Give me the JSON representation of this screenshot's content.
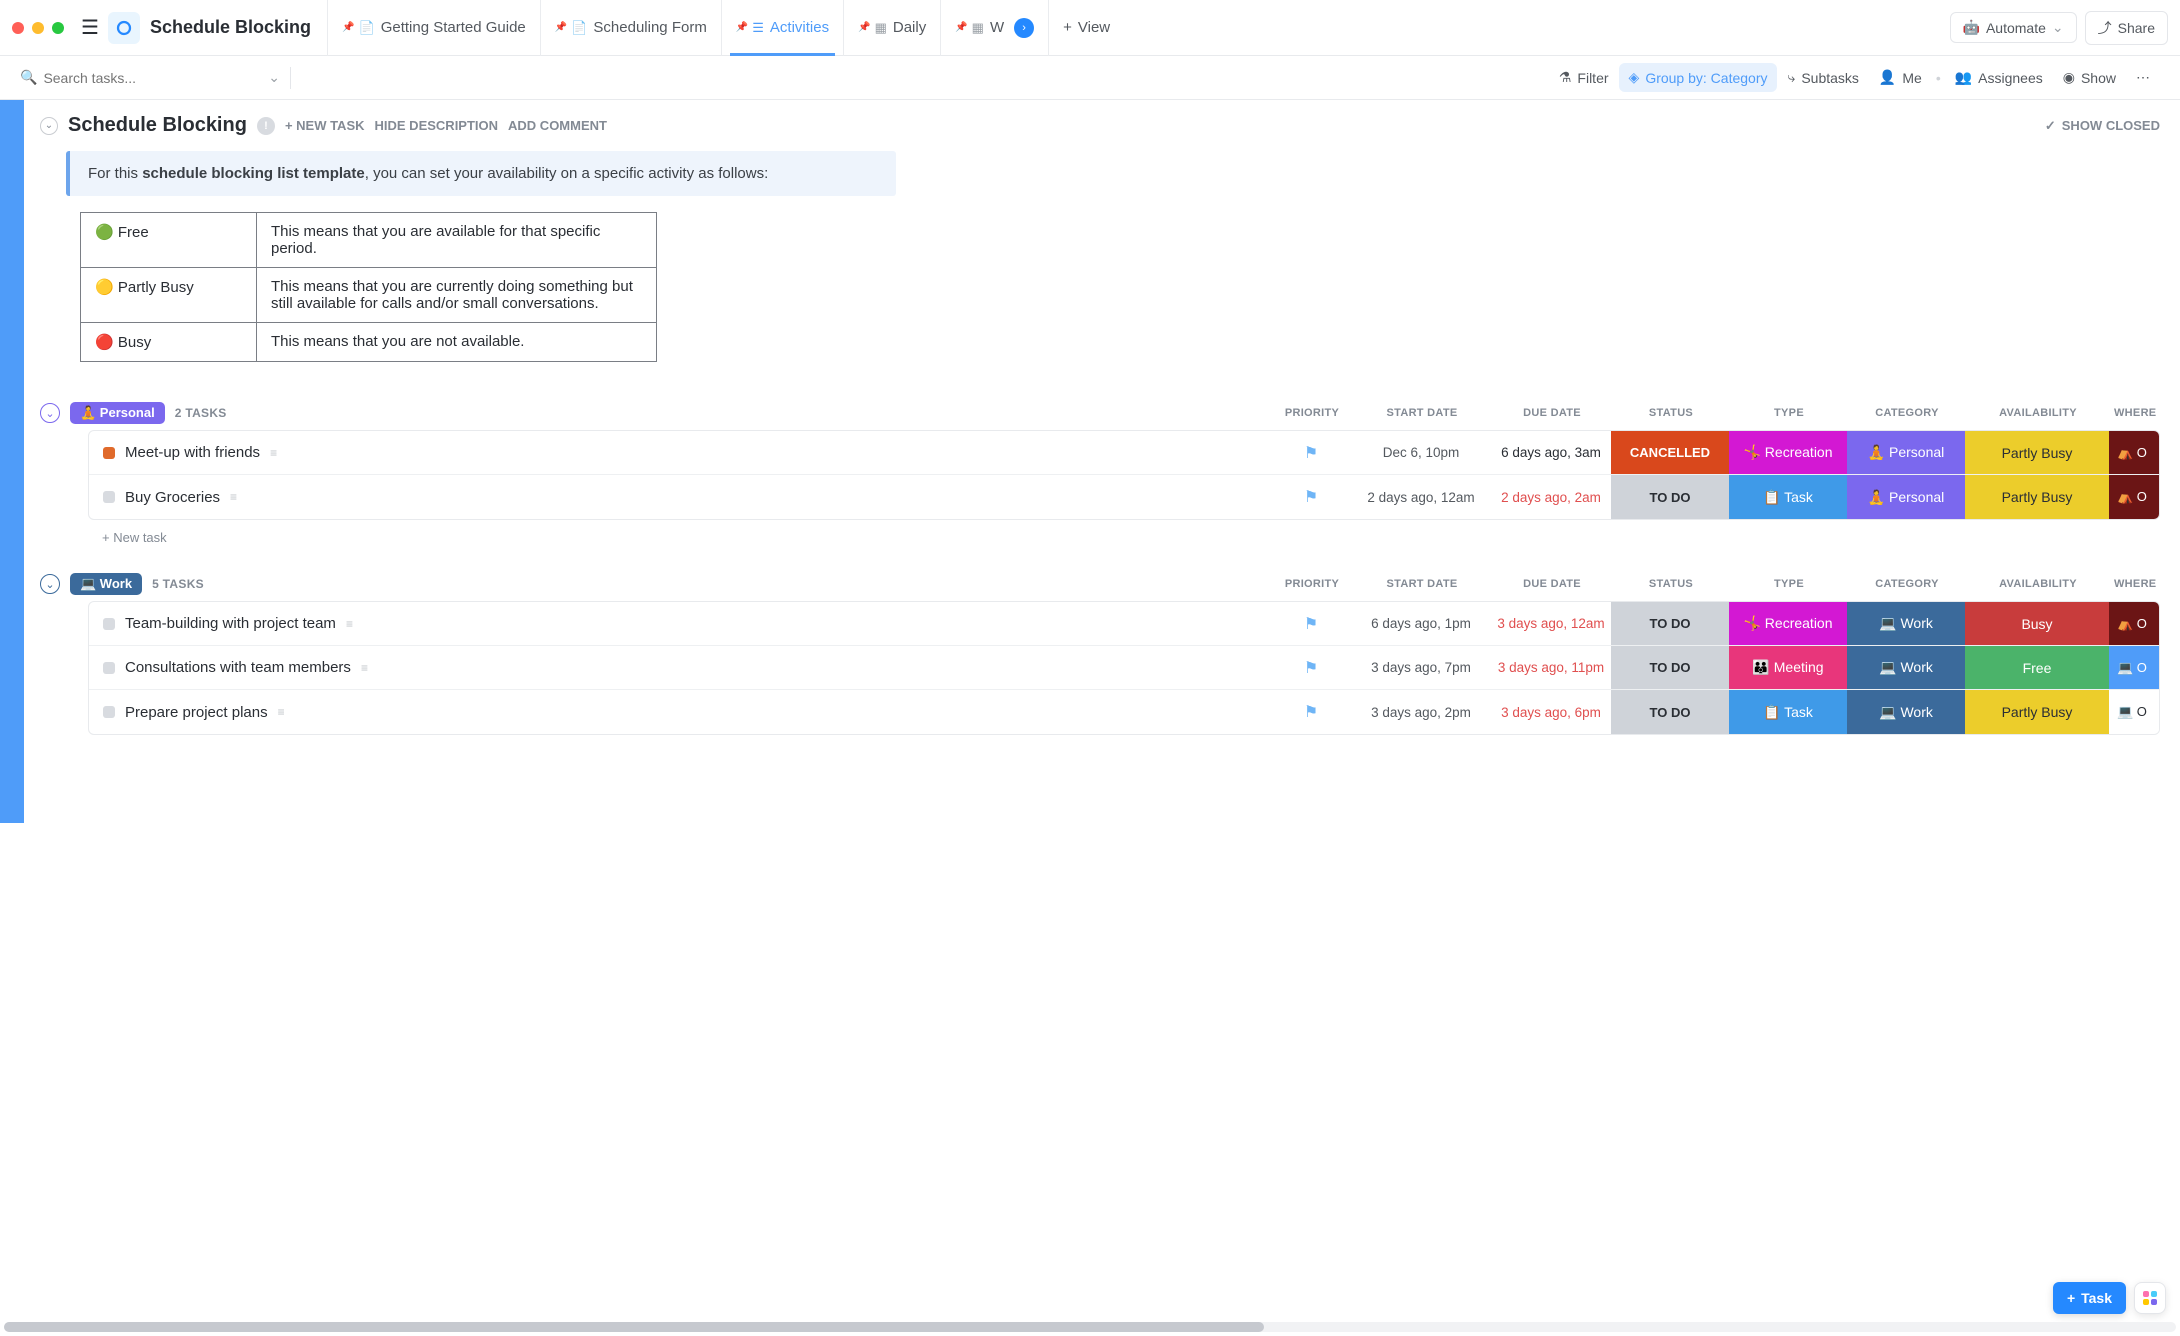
{
  "header": {
    "page_title": "Schedule Blocking",
    "tabs": [
      {
        "label": "Getting Started Guide"
      },
      {
        "label": "Scheduling Form"
      },
      {
        "label": "Activities",
        "active": true
      },
      {
        "label": "Daily"
      },
      {
        "label": "W"
      }
    ],
    "view_btn": "View",
    "automate_btn": "Automate",
    "share_btn": "Share"
  },
  "toolrow": {
    "search_placeholder": "Search tasks...",
    "filter": "Filter",
    "groupby": "Group by: Category",
    "subtasks": "Subtasks",
    "me": "Me",
    "assignees": "Assignees",
    "show": "Show"
  },
  "section": {
    "title": "Schedule Blocking",
    "new_task": "+ NEW TASK",
    "hide_desc": "HIDE DESCRIPTION",
    "add_comment": "ADD COMMENT",
    "show_closed": "SHOW CLOSED"
  },
  "description": {
    "prefix": "For this ",
    "bold": "schedule blocking list template",
    "suffix": ", you can set your availability on a specific activity as follows:"
  },
  "legend": [
    {
      "label": "🟢 Free",
      "desc": "This means that you are available for that specific period."
    },
    {
      "label": "🟡 Partly Busy",
      "desc": "This means that you are currently doing something but still available for calls and/or small conversations."
    },
    {
      "label": "🔴 Busy",
      "desc": "This means that you are not available."
    }
  ],
  "columns": {
    "priority": "PRIORITY",
    "start": "START DATE",
    "due": "DUE DATE",
    "status": "STATUS",
    "type": "TYPE",
    "category": "CATEGORY",
    "availability": "AVAILABILITY",
    "where": "WHERE"
  },
  "groups": [
    {
      "name": "Personal",
      "emoji": "🧘",
      "color": "#7b68ee",
      "collapse_color": "#7b68ee",
      "task_count": "2 TASKS",
      "tasks": [
        {
          "name": "Meet-up with friends",
          "status_color": "#e06a2b",
          "start": "Dec 6, 10pm",
          "due": "6 days ago, 3am",
          "due_overdue": false,
          "status": {
            "label": "CANCELLED",
            "bg": "#d9481c",
            "fg": "#ffffff"
          },
          "type": {
            "label": "🤸 Recreation",
            "bg": "#d318d3",
            "fg": "#ffffff"
          },
          "category": {
            "label": "🧘 Personal",
            "bg": "#7b68ee",
            "fg": "#ffffff"
          },
          "availability": {
            "label": "Partly Busy",
            "bg": "#eccd2b",
            "fg": "#2a2e34"
          },
          "where": {
            "label": "⛺ O",
            "bg": "#6b1515",
            "fg": "#ffffff"
          }
        },
        {
          "name": "Buy Groceries",
          "status_color": "#d8dbe0",
          "start": "2 days ago, 12am",
          "due": "2 days ago, 2am",
          "due_overdue": true,
          "status": {
            "label": "TO DO",
            "bg": "#cfd3d9",
            "fg": "#2a2e34"
          },
          "type": {
            "label": "📋 Task",
            "bg": "#3f9ae8",
            "fg": "#ffffff"
          },
          "category": {
            "label": "🧘 Personal",
            "bg": "#7b68ee",
            "fg": "#ffffff"
          },
          "availability": {
            "label": "Partly Busy",
            "bg": "#eccd2b",
            "fg": "#2a2e34"
          },
          "where": {
            "label": "⛺ O",
            "bg": "#6b1515",
            "fg": "#ffffff"
          }
        }
      ],
      "new_task": "+ New task"
    },
    {
      "name": "Work",
      "emoji": "💻",
      "color": "#3b6a9b",
      "collapse_color": "#3b6a9b",
      "task_count": "5 TASKS",
      "tasks": [
        {
          "name": "Team-building with project team",
          "status_color": "#d8dbe0",
          "start": "6 days ago, 1pm",
          "due": "3 days ago, 12am",
          "due_overdue": true,
          "status": {
            "label": "TO DO",
            "bg": "#cfd3d9",
            "fg": "#2a2e34"
          },
          "type": {
            "label": "🤸 Recreation",
            "bg": "#d318d3",
            "fg": "#ffffff"
          },
          "category": {
            "label": "💻 Work",
            "bg": "#3b6a9b",
            "fg": "#ffffff"
          },
          "availability": {
            "label": "Busy",
            "bg": "#c83c3c",
            "fg": "#ffffff"
          },
          "where": {
            "label": "⛺ O",
            "bg": "#6b1515",
            "fg": "#ffffff"
          }
        },
        {
          "name": "Consultations with team members",
          "status_color": "#d8dbe0",
          "start": "3 days ago, 7pm",
          "due": "3 days ago, 11pm",
          "due_overdue": true,
          "status": {
            "label": "TO DO",
            "bg": "#cfd3d9",
            "fg": "#2a2e34"
          },
          "type": {
            "label": "👪 Meeting",
            "bg": "#e8367b",
            "fg": "#ffffff"
          },
          "category": {
            "label": "💻 Work",
            "bg": "#3b6a9b",
            "fg": "#ffffff"
          },
          "availability": {
            "label": "Free",
            "bg": "#4bb36a",
            "fg": "#ffffff"
          },
          "where": {
            "label": "💻 O",
            "bg": "#4f9cf9",
            "fg": "#ffffff"
          }
        },
        {
          "name": "Prepare project plans",
          "status_color": "#d8dbe0",
          "start": "3 days ago, 2pm",
          "due": "3 days ago, 6pm",
          "due_overdue": true,
          "status": {
            "label": "TO DO",
            "bg": "#cfd3d9",
            "fg": "#2a2e34"
          },
          "type": {
            "label": "📋 Task",
            "bg": "#3f9ae8",
            "fg": "#ffffff"
          },
          "category": {
            "label": "💻 Work",
            "bg": "#3b6a9b",
            "fg": "#ffffff"
          },
          "availability": {
            "label": "Partly Busy",
            "bg": "#eccd2b",
            "fg": "#2a2e34"
          },
          "where": {
            "label": "💻 O",
            "bg": "#ffffff",
            "fg": "#2a2e34"
          }
        }
      ]
    }
  ],
  "float": {
    "task": "Task"
  }
}
